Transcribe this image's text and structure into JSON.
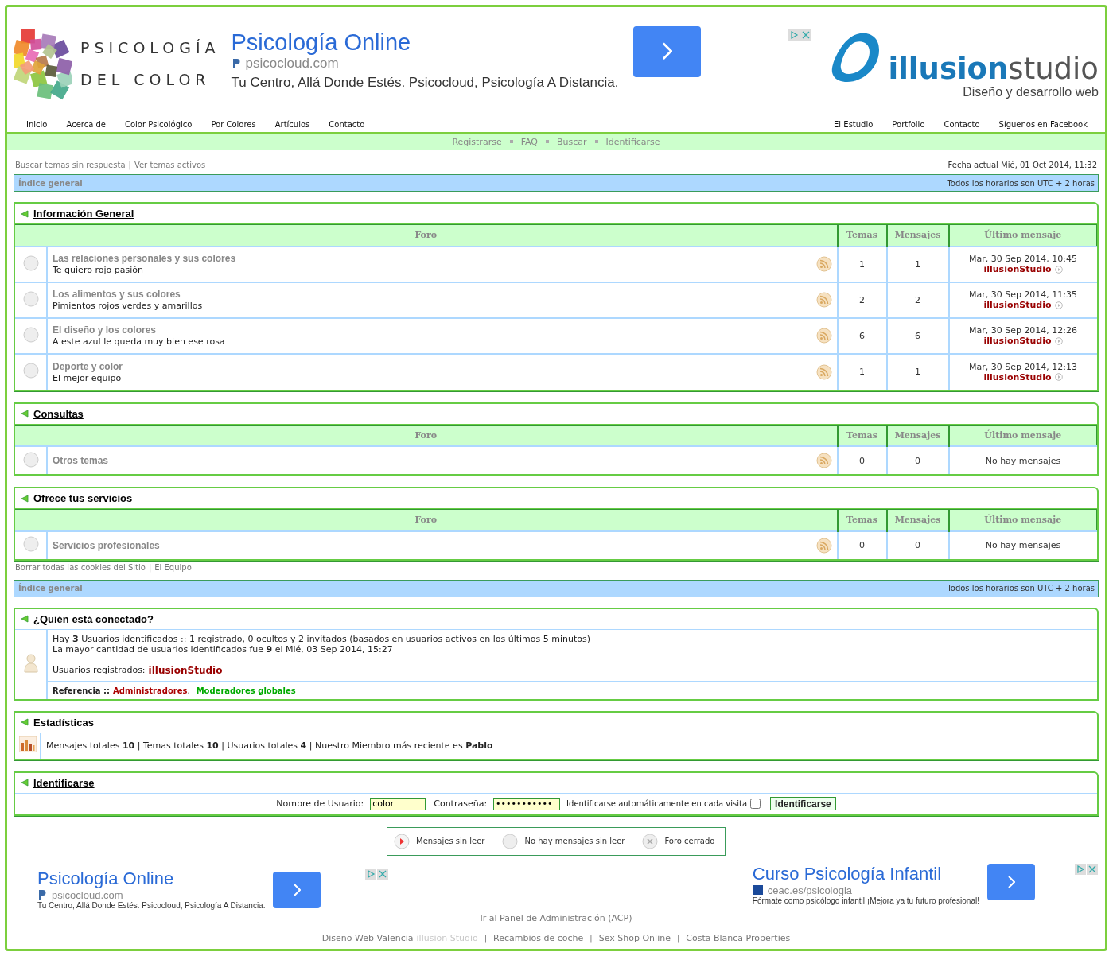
{
  "logo": {
    "line1": "PSICOLOGÍA",
    "line2": "DEL COLOR"
  },
  "top_ad": {
    "title": "Psicología Online",
    "domain": "psicocloud.com",
    "text": "Tu Centro, Allá Donde Estés. Psicocloud, Psicología A Distancia."
  },
  "studio_logo": {
    "brand_first": "illusion",
    "brand_second": "studio",
    "tagline": "Diseño y desarrollo web"
  },
  "nav_left": [
    "Inicio",
    "Acerca de",
    "Color Psicológico",
    "Por Colores",
    "Artículos",
    "Contacto"
  ],
  "nav_right": [
    "El Estudio",
    "Portfolio",
    "Contacto",
    "Síguenos en Facebook"
  ],
  "user_links": [
    "Registrarse",
    "FAQ",
    "Buscar",
    "Identificarse"
  ],
  "quick_links": [
    "Buscar temas sin respuesta",
    "Ver temas activos"
  ],
  "link_separator": "|",
  "current_date": "Fecha actual Mié, 01 Oct 2014, 11:32",
  "breadcrumb_top": {
    "label": "Índice general",
    "timezone": "Todos los horarios son UTC + 2 horas"
  },
  "categories": [
    {
      "title": "Información General",
      "columns": [
        "Foro",
        "Temas",
        "Mensajes",
        "Último mensaje"
      ],
      "forums": [
        {
          "name": "Las relaciones personales y sus colores",
          "description": "Te quiero rojo pasión",
          "topics": "1",
          "posts": "1",
          "last_date": "Mar, 30 Sep 2014, 10:45",
          "last_author": "illusionStudio"
        },
        {
          "name": "Los alimentos y sus colores",
          "description": "Pimientos rojos verdes y amarillos",
          "topics": "2",
          "posts": "2",
          "last_date": "Mar, 30 Sep 2014, 11:35",
          "last_author": "illusionStudio"
        },
        {
          "name": "El diseño y los colores",
          "description": "A este azul le queda muy bien ese rosa",
          "topics": "6",
          "posts": "6",
          "last_date": "Mar, 30 Sep 2014, 12:26",
          "last_author": "illusionStudio"
        },
        {
          "name": "Deporte y color",
          "description": "El mejor equipo",
          "topics": "1",
          "posts": "1",
          "last_date": "Mar, 30 Sep 2014, 12:13",
          "last_author": "illusionStudio"
        }
      ]
    },
    {
      "title": "Consultas",
      "columns": [
        "Foro",
        "Temas",
        "Mensajes",
        "Último mensaje"
      ],
      "forums": [
        {
          "name": "Otros temas",
          "topics": "0",
          "posts": "0",
          "no_posts": "No hay mensajes"
        }
      ]
    },
    {
      "title": "Ofrece tus servicios",
      "columns": [
        "Foro",
        "Temas",
        "Mensajes",
        "Último mensaje"
      ],
      "forums": [
        {
          "name": "Servicios profesionales",
          "topics": "0",
          "posts": "0",
          "no_posts": "No hay mensajes"
        }
      ]
    }
  ],
  "footer_links": [
    "Borrar todas las cookies del Sitio",
    "El Equipo"
  ],
  "breadcrumb_bottom": {
    "label": "Índice general",
    "timezone": "Todos los horarios son UTC + 2 horas"
  },
  "who_is_online": {
    "title": "¿Quién está conectado?",
    "line1": "Hay **3** Usuarios identificados :: 1 registrado, 0 ocultos y 2 invitados (basados en usuarios activos en los últimos 5 minutos)",
    "line2": "La mayor cantidad de usuarios identificados fue **9** el Mié, 03 Sep 2014, 15:27",
    "registered_label": "Usuarios registrados:",
    "registered_user": "illusionStudio",
    "legend_label": "Referencia ::",
    "group_separator": ",",
    "groups": [
      {
        "name": "Administradores",
        "color": "#aa0000"
      },
      {
        "name": "Moderadores globales",
        "color": "#00aa00"
      }
    ]
  },
  "statistics": {
    "title": "Estadísticas",
    "text": "Mensajes totales **10** | Temas totales **10** | Usuarios totales **4** | Nuestro Miembro más reciente es **Pablo**"
  },
  "login": {
    "title": "Identificarse",
    "username_label": "Nombre de Usuario:",
    "username": "color",
    "password_label": "Contraseña:",
    "password": "•••••••••••",
    "autologin_label": "Identificarse automáticamente en cada visita",
    "autologin_checked": false,
    "submit": "Identificarse"
  },
  "legend": [
    {
      "kind": "unread",
      "label": "Mensajes sin leer"
    },
    {
      "kind": "read",
      "label": "No hay mensajes sin leer"
    },
    {
      "kind": "locked",
      "label": "Foro cerrado"
    }
  ],
  "bottom_ads": [
    {
      "title": "Psicología Online",
      "domain": "psicocloud.com",
      "text": "Tu Centro, Allá Donde Estés. Psicocloud, Psicología A Distancia."
    },
    {
      "title": "Curso Psicología Infantil",
      "domain": "ceac.es/psicologia",
      "text": "Fórmate como psicólogo infantil ¡Mejora ya tu futuro profesional!"
    }
  ],
  "admin_link": "Ir al Panel de Administración (ACP)",
  "credits": [
    {
      "kind": "plain",
      "label": "Diseño Web Valencia"
    },
    {
      "kind": "faded",
      "label": "illusion Studio"
    },
    {
      "kind": "plain",
      "label": "Recambios de coche"
    },
    {
      "kind": "plain",
      "label": "Sex Shop Online"
    },
    {
      "kind": "plain",
      "label": "Costa Blanca Properties"
    }
  ]
}
